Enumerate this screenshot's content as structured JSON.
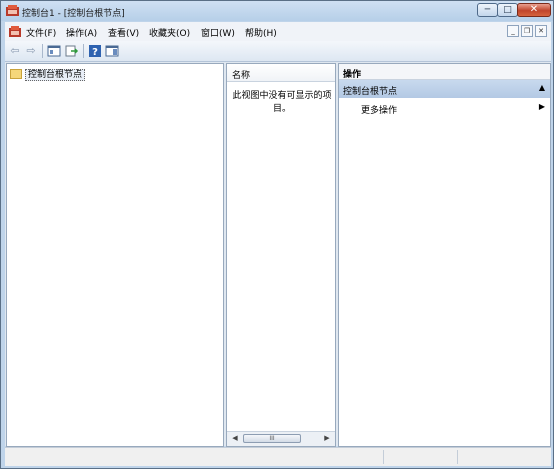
{
  "window": {
    "title": "控制台1 - [控制台根节点]",
    "controls": {
      "minimize": "─",
      "maximize": "□",
      "close": "✕"
    }
  },
  "menubar": {
    "items": [
      "文件(F)",
      "操作(A)",
      "查看(V)",
      "收藏夹(O)",
      "窗口(W)",
      "帮助(H)"
    ],
    "mdi_controls": {
      "minimize": "_",
      "restore": "❐",
      "close": "✕"
    }
  },
  "toolbar": {
    "icons": [
      "back-icon",
      "forward-icon",
      "show-hide-tree-icon",
      "export-list-icon",
      "help-icon",
      "show-hide-action-pane-icon"
    ]
  },
  "tree": {
    "root_label": "控制台根节点"
  },
  "list": {
    "column_header": "名称",
    "empty_message": "此视图中没有可显示的项目。",
    "scroll_thumb": "III"
  },
  "actions": {
    "header": "操作",
    "section_title": "控制台根节点",
    "more_actions": "更多操作"
  },
  "colors": {
    "frame": "#bfd4ea",
    "section_highlight": "#b3c9e4",
    "close_button": "#c0452c"
  }
}
